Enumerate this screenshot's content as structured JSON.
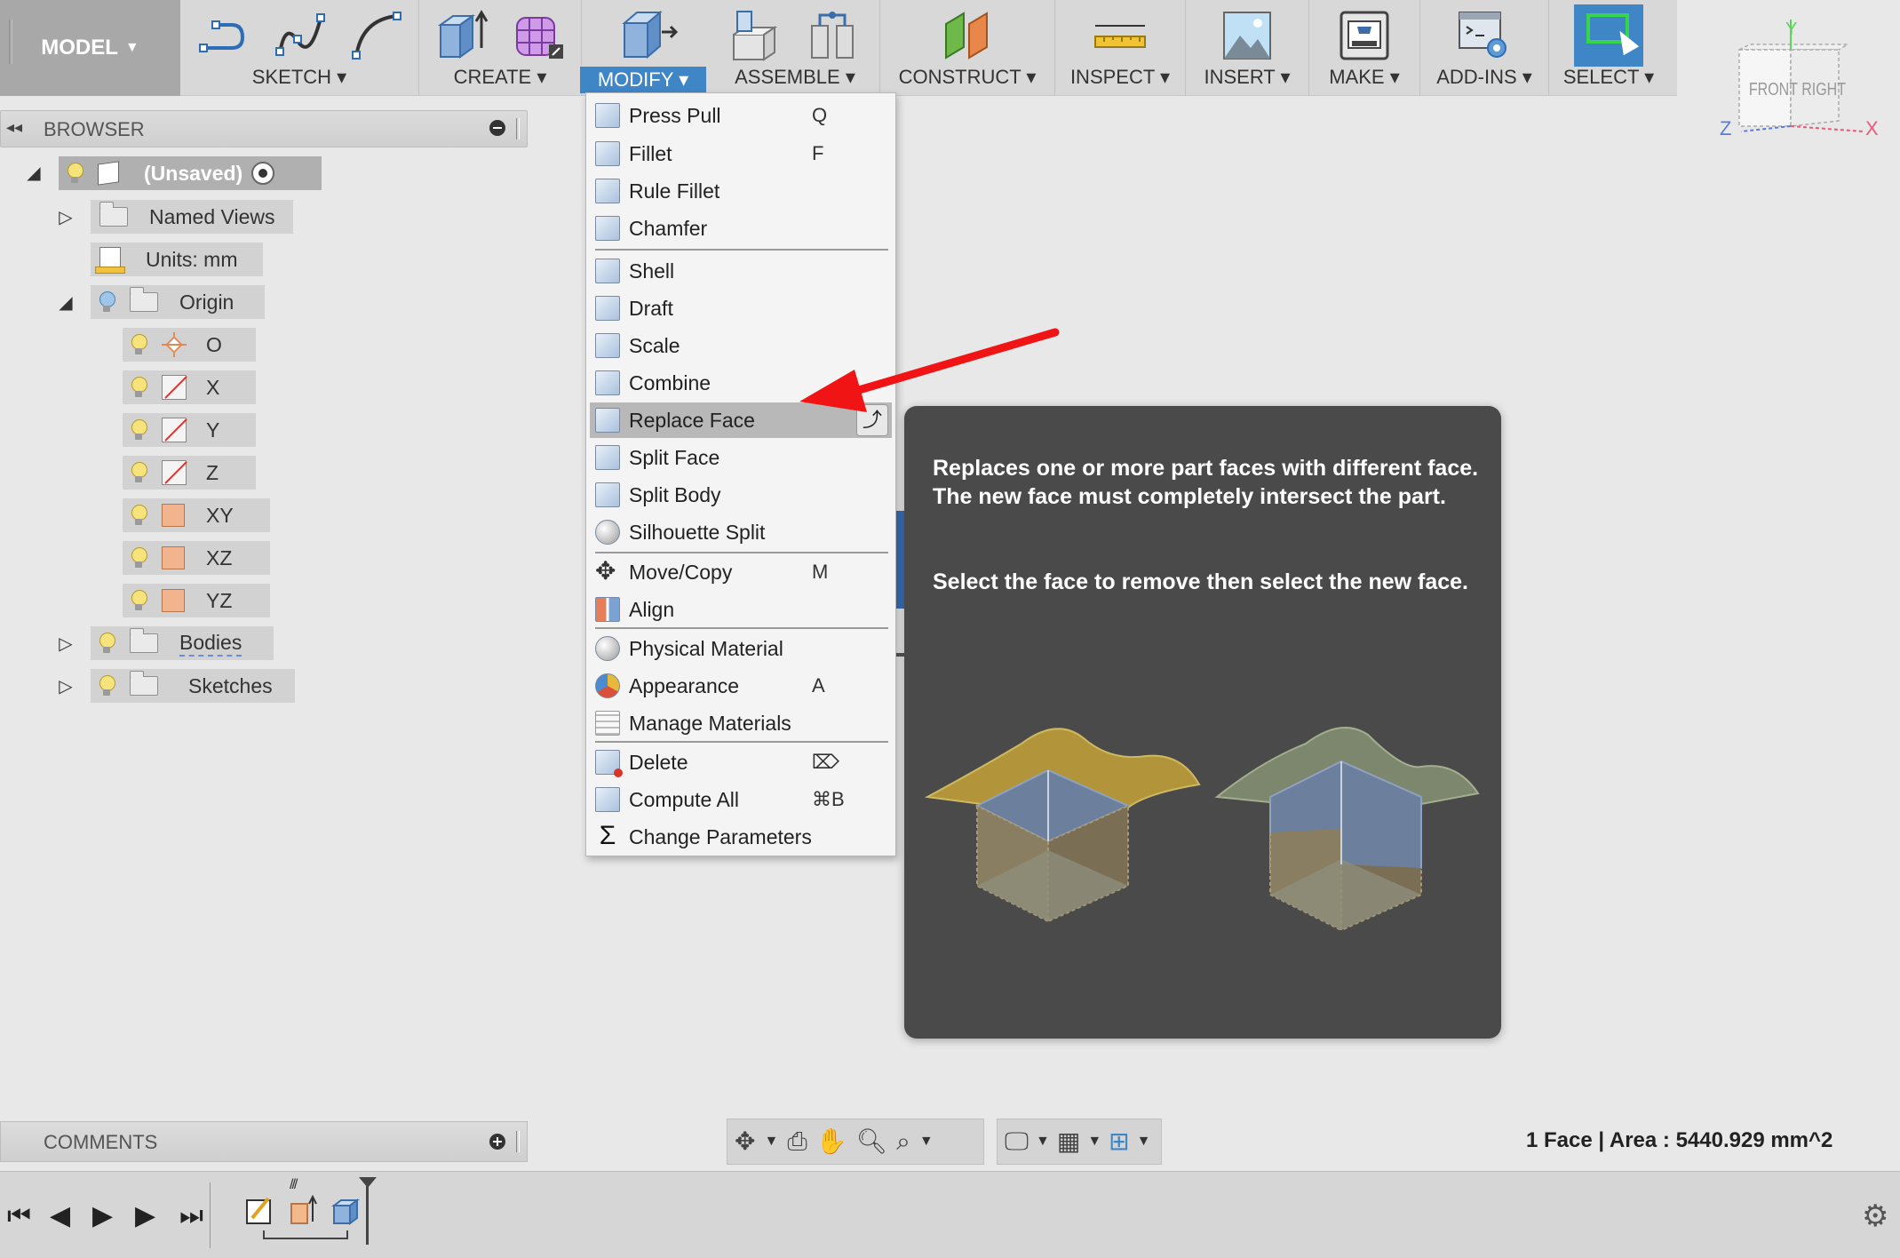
{
  "toolbar": {
    "workspace": "MODEL",
    "groups": [
      {
        "label": "SKETCH"
      },
      {
        "label": "CREATE"
      },
      {
        "label": "MODIFY"
      },
      {
        "label": "ASSEMBLE"
      },
      {
        "label": "CONSTRUCT"
      },
      {
        "label": "INSPECT"
      },
      {
        "label": "INSERT"
      },
      {
        "label": "MAKE"
      },
      {
        "label": "ADD-INS"
      },
      {
        "label": "SELECT"
      }
    ],
    "active_group": "MODIFY",
    "accent_color": "#3f86c6"
  },
  "viewcube": {
    "front": "FRONT",
    "right": "RIGHT",
    "axis_x": "X",
    "axis_y": "Y",
    "axis_z": "Z"
  },
  "browser": {
    "title": "BROWSER",
    "root": "(Unsaved)",
    "items": {
      "named_views": "Named Views",
      "units": "Units: mm",
      "origin": "Origin",
      "o": "O",
      "x": "X",
      "y": "Y",
      "z": "Z",
      "xy": "XY",
      "xz": "XZ",
      "yz": "YZ",
      "bodies": "Bodies",
      "sketches": "Sketches"
    }
  },
  "modify_menu": {
    "items": [
      {
        "label": "Press Pull",
        "shortcut": "Q",
        "icon": "press-pull-icon"
      },
      {
        "label": "Fillet",
        "shortcut": "F",
        "icon": "fillet-icon"
      },
      {
        "label": "Rule Fillet",
        "shortcut": "",
        "icon": "rule-fillet-icon"
      },
      {
        "label": "Chamfer",
        "shortcut": "",
        "icon": "chamfer-icon"
      },
      {
        "label": "Shell",
        "shortcut": "",
        "icon": "shell-icon"
      },
      {
        "label": "Draft",
        "shortcut": "",
        "icon": "draft-icon"
      },
      {
        "label": "Scale",
        "shortcut": "",
        "icon": "scale-icon"
      },
      {
        "label": "Combine",
        "shortcut": "",
        "icon": "combine-icon"
      },
      {
        "label": "Replace Face",
        "shortcut": "",
        "icon": "replace-face-icon"
      },
      {
        "label": "Split Face",
        "shortcut": "",
        "icon": "split-face-icon"
      },
      {
        "label": "Split Body",
        "shortcut": "",
        "icon": "split-body-icon"
      },
      {
        "label": "Silhouette Split",
        "shortcut": "",
        "icon": "silhouette-split-icon"
      },
      {
        "label": "Move/Copy",
        "shortcut": "M",
        "icon": "move-copy-icon"
      },
      {
        "label": "Align",
        "shortcut": "",
        "icon": "align-icon"
      },
      {
        "label": "Physical Material",
        "shortcut": "",
        "icon": "physical-material-icon"
      },
      {
        "label": "Appearance",
        "shortcut": "A",
        "icon": "appearance-icon"
      },
      {
        "label": "Manage Materials",
        "shortcut": "",
        "icon": "manage-materials-icon"
      },
      {
        "label": "Delete",
        "shortcut": "⌦",
        "icon": "delete-icon"
      },
      {
        "label": "Compute All",
        "shortcut": "⌘B",
        "icon": "compute-all-icon"
      },
      {
        "label": "Change Parameters",
        "shortcut": "",
        "icon": "sigma-icon"
      }
    ],
    "highlighted": "Replace Face"
  },
  "tooltip": {
    "line1": "Replaces one or more part faces with different face. The new face must completely intersect the part.",
    "line2": "Select the face to remove then select the new face."
  },
  "comments": {
    "title": "COMMENTS"
  },
  "status": {
    "text": "1 Face | Area : 5440.929 mm^2"
  }
}
